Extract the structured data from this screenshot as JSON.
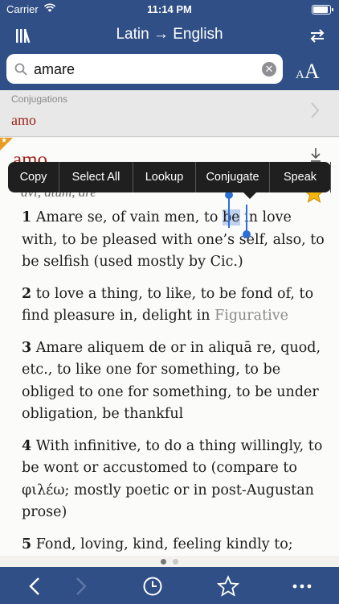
{
  "status_bar": {
    "carrier": "Carrier",
    "time": "11:14 PM",
    "battery_level": 0.95
  },
  "nav": {
    "title": "Latin → English",
    "library_icon": "library-icon",
    "swap_icon": "swap-direction-icon"
  },
  "search": {
    "query": "amare",
    "clear_icon": "clear-icon",
    "clear_glyph": "✕"
  },
  "font_size": {
    "small": "A",
    "large": "A"
  },
  "conjugations": {
    "label": "Conjugations",
    "form": "amo"
  },
  "entry": {
    "headword": "amo",
    "forms": "āvī, ātum, āre",
    "favorite": true,
    "senses": [
      {
        "num": "1",
        "parts": [
          {
            "text": " Amare se, of vain men, to "
          },
          {
            "text": "be",
            "hl": true
          },
          {
            "text": " in love with, to be pleased with one’s self, also, to be selfish (used mostly by Cic.)"
          }
        ]
      },
      {
        "num": "2",
        "parts": [
          {
            "text": " to love a thing, to like, to be fond of, to find pleasure in, delight in "
          },
          {
            "text": "Figurative",
            "note": true
          }
        ]
      },
      {
        "num": "3",
        "parts": [
          {
            "text": " Amare aliquem de or in aliquā re, quod, etc., to like one for something, to be obliged to one for something, to be under obligation, be thankful"
          }
        ]
      },
      {
        "num": "4",
        "parts": [
          {
            "text": " With infinitive, to do a thing willingly, to be wont or accustomed to (compare to φιλέω; mostly poetic or in post-Augustan prose)"
          }
        ]
      },
      {
        "num": "5",
        "parts": [
          {
            "text": " Fond, loving, kind, feeling kindly to;"
          }
        ]
      }
    ]
  },
  "context_menu": [
    {
      "label": "Copy",
      "width": 64
    },
    {
      "label": "Select All",
      "width": 92
    },
    {
      "label": "Lookup",
      "width": 78
    },
    {
      "label": "Conjugate",
      "width": 92
    },
    {
      "label": "Speak",
      "width": 76
    }
  ],
  "pager": {
    "pages": 2,
    "current": 1
  },
  "toolbar": [
    "back-icon",
    "forward-icon",
    "history-icon",
    "favorites-icon",
    "more-icon"
  ],
  "colors": {
    "bar": "#2f4f86",
    "accent": "#9b2218",
    "selection": "#bfd2ee",
    "star": "#e89b1e"
  }
}
